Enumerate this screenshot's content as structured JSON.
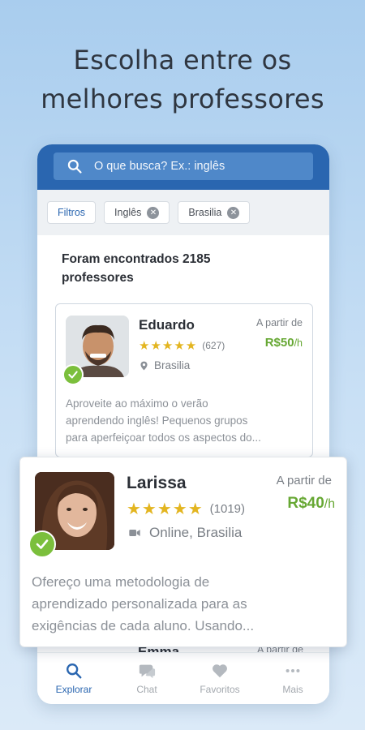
{
  "headline": {
    "line1": "Escolha entre os",
    "line2": "melhores professores"
  },
  "search": {
    "placeholder": "O que busca? Ex.: inglês",
    "icon": "search-icon"
  },
  "filters": {
    "button": "Filtros",
    "chips": [
      {
        "label": "Inglês",
        "remove_icon": "close-icon"
      },
      {
        "label": "Brasilia",
        "remove_icon": "close-icon"
      }
    ]
  },
  "results": {
    "line1": "Foram encontrados 2185",
    "line2": "professores"
  },
  "teachers": [
    {
      "name": "Eduardo",
      "stars": "★★★★★",
      "rating_count": "(627)",
      "location": "Brasilia",
      "location_icon": "pin-icon",
      "price_prefix": "A partir de",
      "price": "R$50",
      "price_unit": "/h",
      "desc1": "Aproveite ao máximo o verão",
      "desc2": "aprendendo inglês! Pequenos grupos",
      "desc3": "para aperfeiçoar todos os aspectos do..."
    },
    {
      "name": "Larissa",
      "stars": "★★★★★",
      "rating_count": "(1019)",
      "location": "Online, Brasilia",
      "location_icon": "video-camera-icon",
      "price_prefix": "A partir de",
      "price": "R$40",
      "price_unit": "/h",
      "desc1": "Ofereço uma metodologia de",
      "desc2": "aprendizado personalizada para as",
      "desc3": "exigências de cada aluno. Usando..."
    },
    {
      "name": "Emma",
      "price_prefix": "A partir de"
    }
  ],
  "nav": [
    {
      "label": "Explorar",
      "icon": "search-icon",
      "active": true
    },
    {
      "label": "Chat",
      "icon": "chat-bubble-icon",
      "active": false
    },
    {
      "label": "Favoritos",
      "icon": "heart-icon",
      "active": false
    },
    {
      "label": "Mais",
      "icon": "more-dots-icon",
      "active": false
    }
  ],
  "colors": {
    "brand_blue": "#2a66b0",
    "price_green": "#67a834",
    "verified_green": "#7bbf3c",
    "star_gold": "#e3b520"
  }
}
